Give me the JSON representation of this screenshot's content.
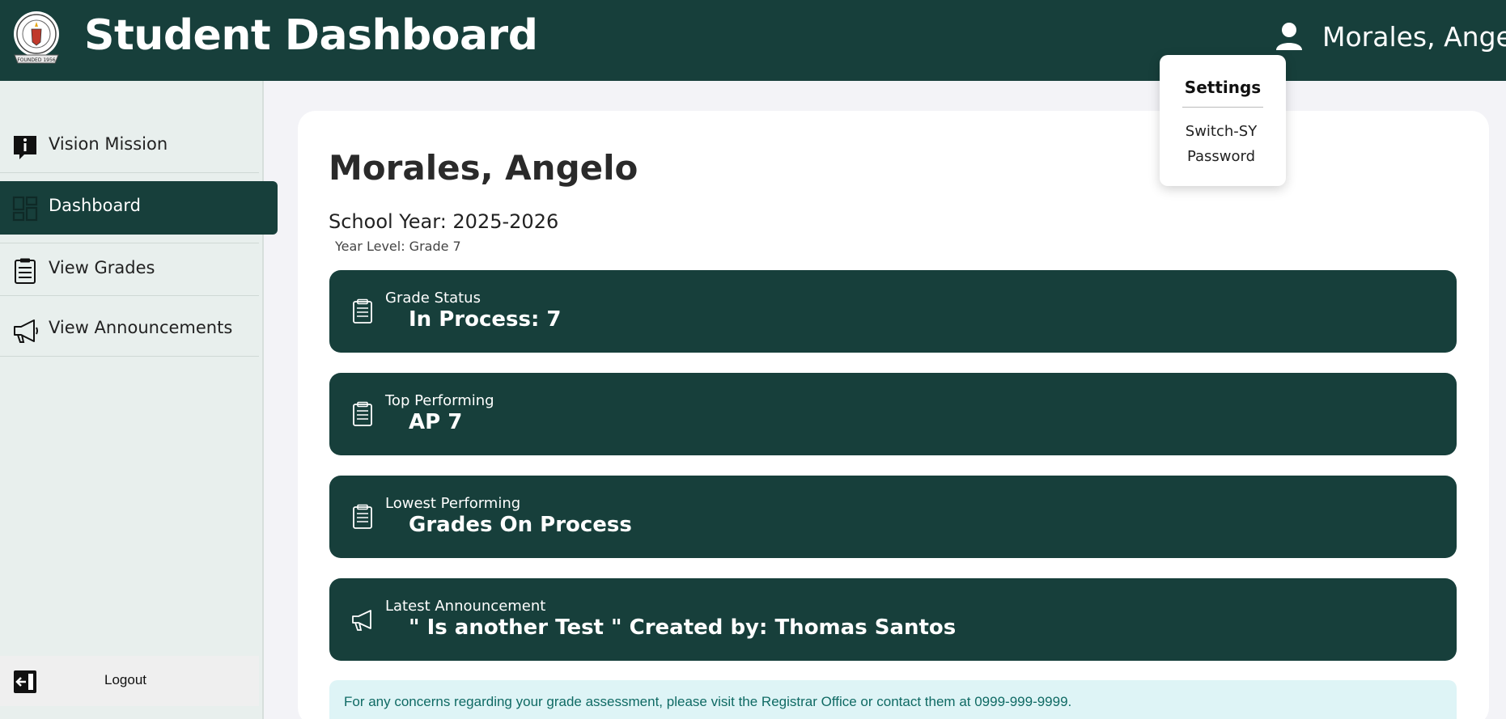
{
  "header": {
    "title": "Student Dashboard",
    "logo_icon": "school-seal-icon",
    "logo_text": "FOUNDED 1956",
    "user_icon": "person-icon",
    "user_name": "Morales, Angelo"
  },
  "sidebar": {
    "items": [
      {
        "label": "Vision Mission",
        "icon": "info-icon",
        "active": false
      },
      {
        "label": "Dashboard",
        "icon": "grid-icon",
        "active": true
      },
      {
        "label": "View Grades",
        "icon": "clipboard-icon",
        "active": false
      },
      {
        "label": "View Announcements",
        "icon": "megaphone-icon",
        "active": false
      }
    ],
    "logout": {
      "label": "Logout",
      "icon": "logout-icon"
    }
  },
  "main": {
    "student_name": "Morales, Angelo",
    "school_year": "School Year: 2025-2026",
    "year_level": "Year Level: Grade 7",
    "stats": [
      {
        "label": "Grade Status",
        "value": "In Process: 7",
        "icon": "clipboard-icon"
      },
      {
        "label": "Top Performing",
        "value": "AP 7",
        "icon": "clipboard-icon"
      },
      {
        "label": "Lowest Performing",
        "value": "Grades On Process",
        "icon": "clipboard-icon"
      },
      {
        "label": "Latest Announcement",
        "value": "\" Is another Test \" Created by: Thomas Santos",
        "icon": "megaphone-icon"
      }
    ],
    "notice": "For any concerns regarding your grade assessment, please visit the Registrar Office or contact them at 0999-999-9999."
  },
  "dropdown": {
    "title": "Settings",
    "items": [
      "Switch-SY",
      "Password"
    ]
  },
  "colors": {
    "brand": "#173f3b",
    "page_bg": "#f3f3f7",
    "sidebar_bg": "#e8efed",
    "notice_bg": "#def4f6",
    "notice_text": "#0f6a64"
  }
}
